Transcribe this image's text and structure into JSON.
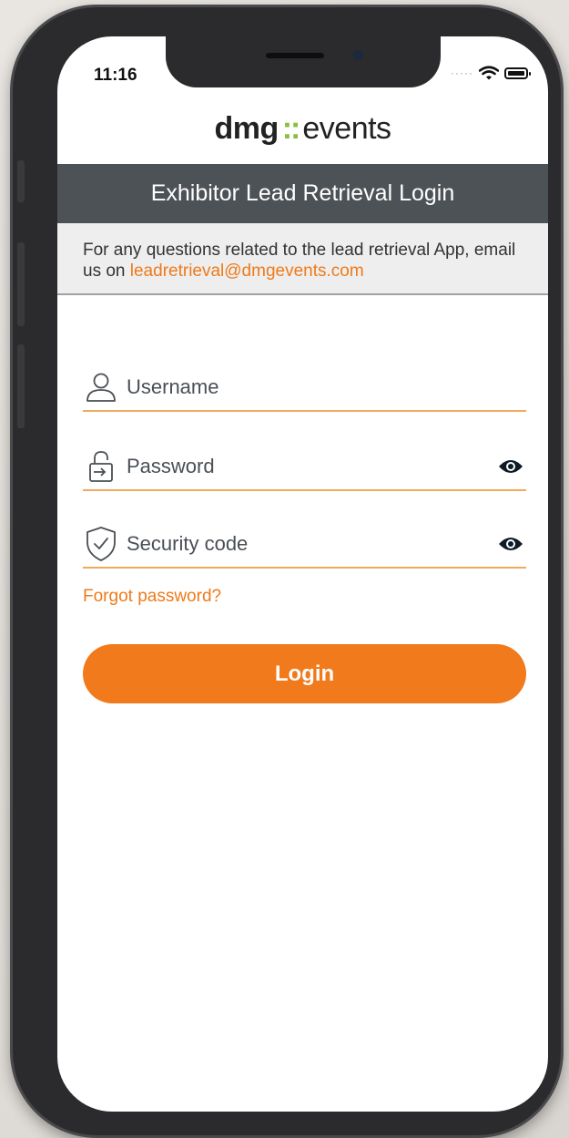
{
  "status_bar": {
    "time": "11:16",
    "signal_icon": "cellular-dots-icon",
    "wifi_icon": "wifi-icon",
    "battery_icon": "battery-icon"
  },
  "logo": {
    "part1": "dmg",
    "part2": "events",
    "separator_color": "#8cbe3f"
  },
  "header": {
    "title": "Exhibitor Lead Retrieval Login"
  },
  "info": {
    "text": "For any questions related to the lead retrieval App, email us on",
    "email": "leadretrieval@dmgevents.com"
  },
  "form": {
    "username": {
      "placeholder": "Username",
      "icon": "user-icon"
    },
    "password": {
      "placeholder": "Password",
      "icon": "lock-icon",
      "toggle_icon": "eye-icon"
    },
    "security_code": {
      "placeholder": "Security code",
      "icon": "shield-check-icon",
      "toggle_icon": "eye-icon"
    },
    "forgot_label": "Forgot password?",
    "login_label": "Login"
  },
  "colors": {
    "accent": "#f07a1c",
    "header_bg": "#4d5256",
    "info_bg": "#eeeeee"
  }
}
